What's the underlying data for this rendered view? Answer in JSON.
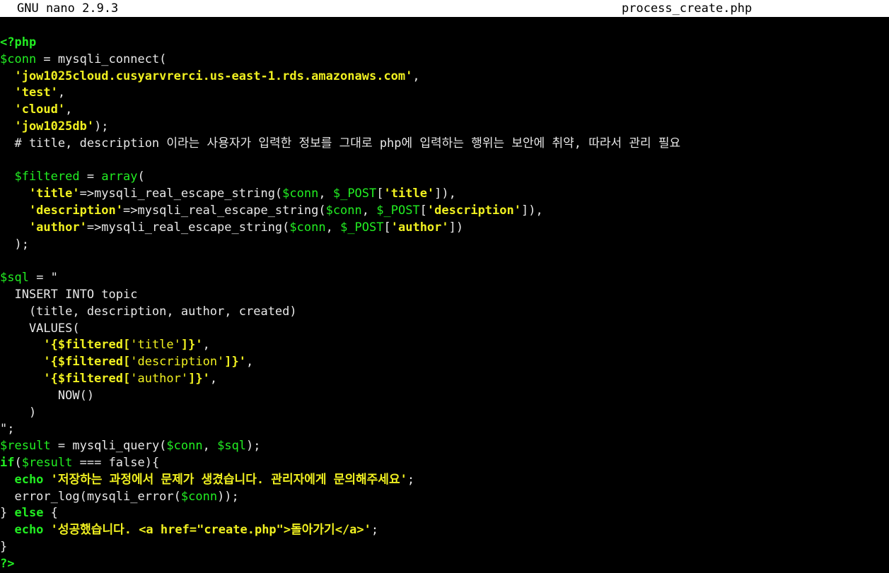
{
  "titlebar": {
    "app": "GNU nano 2.9.3",
    "filename": "process_create.php"
  },
  "code": {
    "l1": "<?php",
    "l2a": "$conn",
    "l2b": " = mysqli_connect(",
    "l3": "  'jow1025cloud.cusyarvrerci.us-east-1.rds.amazonaws.com'",
    "l3b": ",",
    "l4": "  'test'",
    "l4b": ",",
    "l5": "  'cloud'",
    "l5b": ",",
    "l6": "  'jow1025db'",
    "l6b": ");",
    "l7": "  # title, description 이라는 사용자가 입력한 정보를 그대로 php에 입력하는 행위는 보안에 취약, 따라서 관리 필요",
    "l9a": "  $filtered",
    "l9b": " = ",
    "l9c": "array",
    "l9d": "(",
    "l10a": "    'title'",
    "l10b": "=>mysqli_real_escape_string(",
    "l10c": "$conn",
    "l10d": ", ",
    "l10e": "$_POST",
    "l10f": "[",
    "l10g": "'title'",
    "l10h": "]),",
    "l11a": "    'description'",
    "l11b": "=>mysqli_real_escape_string(",
    "l11c": "$conn",
    "l11d": ", ",
    "l11e": "$_POST",
    "l11f": "[",
    "l11g": "'description'",
    "l11h": "]),",
    "l12a": "    'author'",
    "l12b": "=>mysqli_real_escape_string(",
    "l12c": "$conn",
    "l12d": ", ",
    "l12e": "$_POST",
    "l12f": "[",
    "l12g": "'author'",
    "l12h": "])",
    "l13": "  );",
    "l15a": "$sql",
    "l15b": " = \"",
    "l16": "  INSERT INTO topic",
    "l17": "    (title, description, author, created)",
    "l18": "    VALUES(",
    "l19a": "      '{$filtered[",
    "l19b": "'title'",
    "l19c": "]}'",
    "l19d": ",",
    "l20a": "      '{$filtered[",
    "l20b": "'description'",
    "l20c": "]}'",
    "l20d": ",",
    "l21a": "      '{$filtered[",
    "l21b": "'author'",
    "l21c": "]}'",
    "l21d": ",",
    "l22": "        NOW()",
    "l23": "    )",
    "l24": "\";",
    "l25a": "$result",
    "l25b": " = mysqli_query(",
    "l25c": "$conn",
    "l25d": ", ",
    "l25e": "$sql",
    "l25f": ");",
    "l26a": "if",
    "l26b": "(",
    "l26c": "$result",
    "l26d": " === false){",
    "l27a": "  echo",
    "l27b": " '저장하는 과정에서 문제가 생겼습니다. 관리자에게 문의해주세요'",
    "l27c": ";",
    "l28a": "  error_log(mysqli_error(",
    "l28b": "$conn",
    "l28c": "));",
    "l29a": "} ",
    "l29b": "else",
    "l29c": " {",
    "l30a": "  echo",
    "l30b": " '성공했습니다. <a href=\"create.php\">돌아가기</a>'",
    "l30c": ";",
    "l31": "}",
    "l32": "?>"
  },
  "colors": {
    "background": "#000000",
    "titlebar_bg": "#ffffff",
    "variable": "#22ee22",
    "string": "#f0f020",
    "keyword": "#2d6cff",
    "default": "#d8d8d8"
  }
}
